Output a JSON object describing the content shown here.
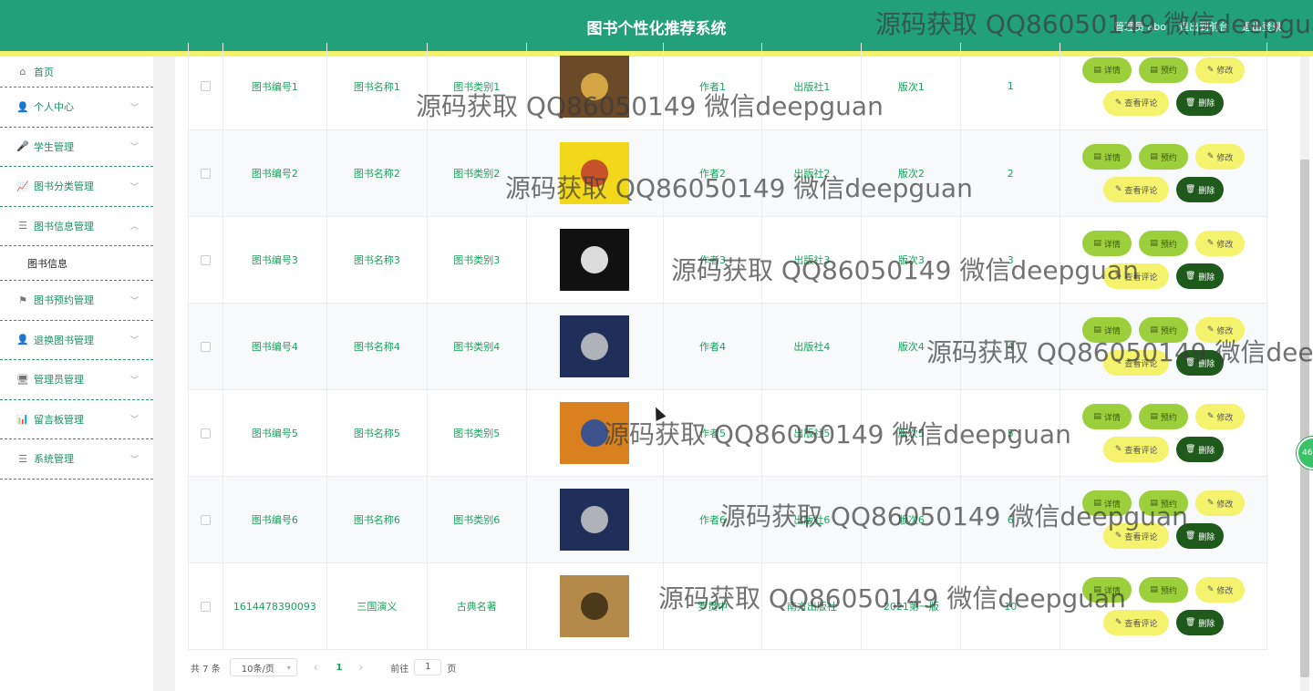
{
  "header": {
    "title": "图书个性化推荐系统",
    "links": [
      "管理员 abo",
      "退出到前台",
      "退出登录"
    ]
  },
  "sidebar": {
    "items": [
      {
        "label": "首页",
        "icon": "home-icon",
        "glyph": "⌂"
      },
      {
        "label": "个人中心",
        "icon": "user-icon",
        "glyph": "👤"
      },
      {
        "label": "学生管理",
        "icon": "mic-icon",
        "glyph": "🎤"
      },
      {
        "label": "图书分类管理",
        "icon": "chart-icon",
        "glyph": "📈"
      },
      {
        "label": "图书信息管理",
        "icon": "list-icon",
        "glyph": "☰"
      },
      {
        "label": "图书预约管理",
        "icon": "flag-icon",
        "glyph": "⚑"
      },
      {
        "label": "退换图书管理",
        "icon": "user-icon",
        "glyph": "👤"
      },
      {
        "label": "管理员管理",
        "icon": "monitor-icon",
        "glyph": "🖥"
      },
      {
        "label": "留言板管理",
        "icon": "bar-chart-icon",
        "glyph": "📊"
      },
      {
        "label": "系统管理",
        "icon": "list-icon",
        "glyph": "☰"
      }
    ],
    "sub_item": "图书信息"
  },
  "buttons": {
    "detail": "详情",
    "reserve": "预约",
    "edit": "修改",
    "review": "查看评论",
    "delete": "删除"
  },
  "rows": [
    {
      "no": "图书编号1",
      "name": "图书名称1",
      "cat": "图书类别1",
      "author": "作者1",
      "pub": "出版社1",
      "edition": "版次1",
      "qty": "1",
      "cover_color": "#6b4a2a",
      "cover_accent": "#e5b54a"
    },
    {
      "no": "图书编号2",
      "name": "图书名称2",
      "cat": "图书类别2",
      "author": "作者2",
      "pub": "出版社2",
      "edition": "版次2",
      "qty": "2",
      "cover_color": "#f2d81a",
      "cover_accent": "#c0392b"
    },
    {
      "no": "图书编号3",
      "name": "图书名称3",
      "cat": "图书类别3",
      "author": "作者3",
      "pub": "出版社3",
      "edition": "版次3",
      "qty": "3",
      "cover_color": "#111111",
      "cover_accent": "#ffffff"
    },
    {
      "no": "图书编号4",
      "name": "图书名称4",
      "cat": "图书类别4",
      "author": "作者4",
      "pub": "出版社4",
      "edition": "版次4",
      "qty": "4",
      "cover_color": "#1f2f5a",
      "cover_accent": "#c9c9c9"
    },
    {
      "no": "图书编号5",
      "name": "图书名称5",
      "cat": "图书类别5",
      "author": "作者5",
      "pub": "出版社5",
      "edition": "版次5",
      "qty": "5",
      "cover_color": "#d9811f",
      "cover_accent": "#1f4aa0"
    },
    {
      "no": "图书编号6",
      "name": "图书名称6",
      "cat": "图书类别6",
      "author": "作者6",
      "pub": "出版社6",
      "edition": "版次6",
      "qty": "6",
      "cover_color": "#1f2f5a",
      "cover_accent": "#c9c9c9"
    },
    {
      "no": "1614478390093",
      "name": "三国演义",
      "cat": "古典名著",
      "author": "罗贯中",
      "pub": "南方出版社",
      "edition": "2021第一版",
      "qty": "10",
      "cover_color": "#b48a4a",
      "cover_accent": "#3a2a12"
    }
  ],
  "pager": {
    "total": "共 7 条",
    "page_size": "10条/页",
    "prev": "‹",
    "current": "1",
    "next": "›",
    "goto_label": "前往",
    "goto_value": "1",
    "goto_suffix": "页"
  },
  "float_badge": "46",
  "watermark": "源码获取 QQ86050149 微信deepguan"
}
